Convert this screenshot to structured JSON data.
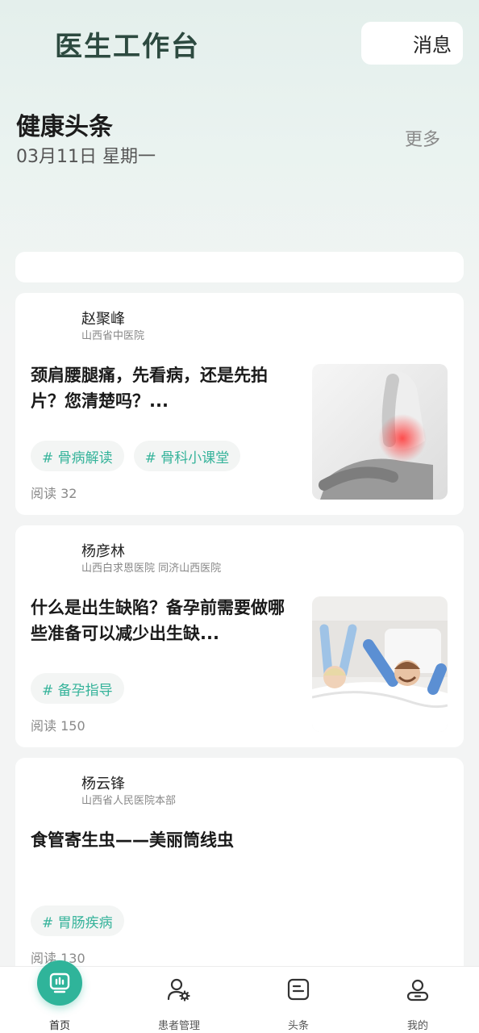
{
  "header": {
    "title": "医生工作台",
    "messages_label": "消息"
  },
  "headlines": {
    "title": "健康头条",
    "date": "03月11日 星期一",
    "more_label": "更多"
  },
  "articles": [
    {
      "author": "赵聚峰",
      "hospital": "山西省中医院",
      "title": "颈肩腰腿痛，先看病，还是先拍片？您清楚吗？...",
      "tags": [
        "# 骨病解读",
        "# 骨科小课堂"
      ],
      "reads": "阅读 32",
      "image": "back-pain-photo"
    },
    {
      "author": "杨彦林",
      "hospital": "山西白求恩医院 同济山西医院",
      "title": "什么是出生缺陷？备孕前需要做哪些准备可以减少出生缺...",
      "tags": [
        "# 备孕指导"
      ],
      "reads": "阅读 150",
      "image": "couple-in-bed-photo"
    },
    {
      "author": "杨云锋",
      "hospital": "山西省人民医院本部",
      "title": "食管寄生虫——美丽筒线虫",
      "tags": [
        "# 胃肠疾病"
      ],
      "reads": "阅读 130",
      "image": ""
    }
  ],
  "nav": {
    "items": [
      {
        "label": "首页",
        "icon": "home-chart-icon",
        "active": true
      },
      {
        "label": "患者管理",
        "icon": "patient-gear-icon",
        "active": false
      },
      {
        "label": "头条",
        "icon": "headline-doc-icon",
        "active": false
      },
      {
        "label": "我的",
        "icon": "profile-icon",
        "active": false
      }
    ]
  },
  "colors": {
    "accent": "#2fb49a",
    "tag_text": "#35b39a",
    "title_dark_green": "#2d4a40"
  }
}
